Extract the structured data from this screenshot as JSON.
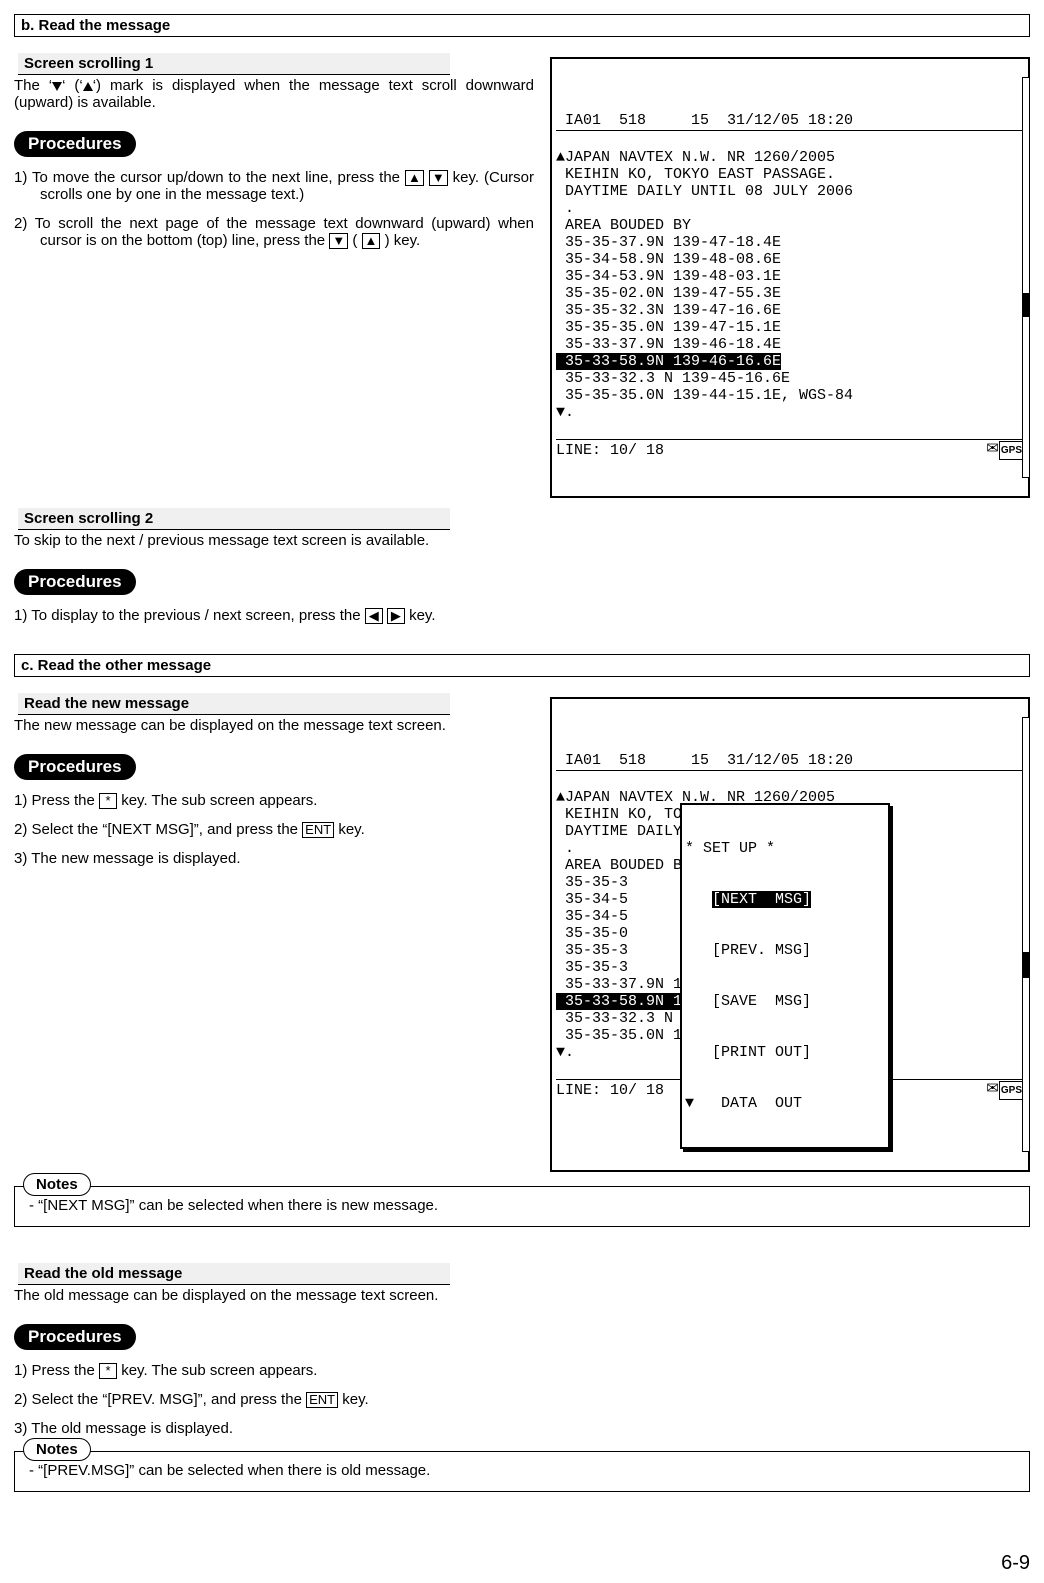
{
  "section_b": {
    "title": "b. Read the message",
    "scroll1_header": "Screen scrolling 1",
    "scroll1_intro_a": "The ‘",
    "scroll1_intro_b": "‘ (‘",
    "scroll1_intro_c": "‘) mark is displayed when the message text scroll downward (upward) is available.",
    "procedures_label": "Procedures",
    "step1_a": "1)  To move the cursor up/down to the next line, press the ",
    "step1_b": " key. (Cursor scrolls one by one in the message text.)",
    "step2_a": "2)  To scroll the next page of the message text downward (upward) when cursor is on the bottom (top) line, press the ",
    "step2_b": " (",
    "step2_c": ") key.",
    "scroll2_header": "Screen scrolling 2",
    "scroll2_intro": "To skip to the next / previous message text screen is available.",
    "scroll2_step1_a": "1)  To display to the previous / next screen, press the ",
    "scroll2_step1_b": " key."
  },
  "section_c": {
    "title": "c. Read the other message",
    "new_header": "Read the new message",
    "new_intro": "The new message can be displayed on the message text screen.",
    "new_step1_a": "1)  Press the ",
    "new_step1_b": " key. The sub screen appears.",
    "new_step2_a": "2)  Select the “[NEXT MSG]”, and press the ",
    "new_step2_b": " key.",
    "new_step3": "3)  The new message is displayed.",
    "new_note": "- “[NEXT MSG]” can be selected when there is new message.",
    "old_header": "Read the old message",
    "old_intro": "The old message can be displayed on the message text screen.",
    "old_step1_a": "1)  Press the ",
    "old_step1_b": " key. The sub screen appears.",
    "old_step2_a": "2)  Select the “[PREV. MSG]”, and press the ",
    "old_step2_b": " key.",
    "old_step3": "3)  The old message is displayed.",
    "old_note": "- “[PREV.MSG]” can be selected when there is old message."
  },
  "keys": {
    "up": "▲",
    "down": "▼",
    "bdown": "▼",
    "bup": "▲",
    "left": "◀",
    "right": "▶",
    "star": "*",
    "ent": "ENT"
  },
  "notes_label": "Notes",
  "lcd1": {
    "header": " IA01  518     15  31/12/05 18:20",
    "lines": [
      "▲JAPAN NAVTEX N.W. NR 1260/2005",
      " KEIHIN KO, TOKYO EAST PASSAGE.",
      " DAYTIME DAILY UNTIL 08 JULY 2006",
      " .",
      " AREA BOUDED BY",
      " 35-35-37.9N 139-47-18.4E",
      " 35-34-58.9N 139-48-08.6E",
      " 35-34-53.9N 139-48-03.1E",
      " 35-35-02.0N 139-47-55.3E",
      " 35-35-32.3N 139-47-16.6E",
      " 35-35-35.0N 139-47-15.1E",
      " 35-33-37.9N 139-46-18.4E"
    ],
    "highlight": " 35-33-58.9N 139-46-16.6E",
    "lines_after": [
      " 35-33-32.3 N 139-45-16.6E",
      " 35-35-35.0N 139-44-15.1E, WGS-84",
      "▼."
    ],
    "footer": "LINE: 10/ 18",
    "gps": "GPS"
  },
  "lcd2": {
    "header": " IA01  518     15  31/12/05 18:20",
    "lines": [
      "▲JAPAN NAVTEX N.W. NR 1260/2005",
      " KEIHIN KO, TOKYO EAST PASSAGE.",
      " DAYTIME DAILY UNTIL 08 JULY 2006",
      " .",
      " AREA BOUDED BY",
      " 35-35-3",
      " 35-34-5",
      " 35-34-5",
      " 35-35-0",
      " 35-35-3",
      " 35-35-3",
      " 35-33-37.9N 139-46-18.4E"
    ],
    "menu_title": "* SET UP *",
    "menu_items": {
      "next": "[NEXT  MSG]",
      "prev": "[PREV. MSG]",
      "save": "[SAVE  MSG]",
      "print": "[PRINT OUT]",
      "data": " DATA  OUT"
    },
    "highlight": " 35-33-58.9N 139-46-16.6E",
    "lines_after": [
      " 35-33-32.3 N 139-45-16.6E",
      " 35-35-35.0N 139-44-15.1E, WGS-84",
      "▼."
    ],
    "footer": "LINE: 10/ 18",
    "gps": "GPS"
  },
  "page_number": "6-9"
}
